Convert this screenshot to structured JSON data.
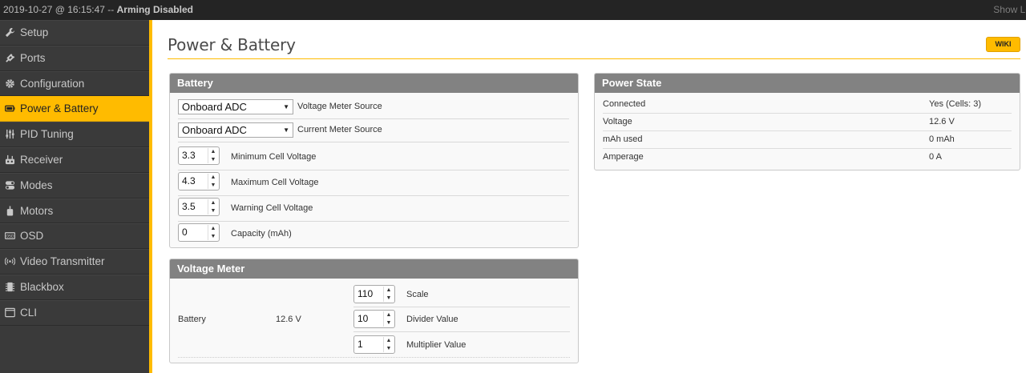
{
  "status_bar": {
    "datetime": "2019-10-27 @ 16:15:47",
    "separator": " -- ",
    "arming": "Arming Disabled",
    "show_log": "Show Lo"
  },
  "sidebar": {
    "items": [
      {
        "label": "Setup",
        "icon": "wrench-icon",
        "active": false
      },
      {
        "label": "Ports",
        "icon": "plug-icon",
        "active": false
      },
      {
        "label": "Configuration",
        "icon": "gear-icon",
        "active": false
      },
      {
        "label": "Power & Battery",
        "icon": "battery-icon",
        "active": true
      },
      {
        "label": "PID Tuning",
        "icon": "sliders-icon",
        "active": false
      },
      {
        "label": "Receiver",
        "icon": "receiver-icon",
        "active": false
      },
      {
        "label": "Modes",
        "icon": "toggles-icon",
        "active": false
      },
      {
        "label": "Motors",
        "icon": "motor-icon",
        "active": false
      },
      {
        "label": "OSD",
        "icon": "osd-icon",
        "active": false
      },
      {
        "label": "Video Transmitter",
        "icon": "antenna-icon",
        "active": false
      },
      {
        "label": "Blackbox",
        "icon": "blackbox-icon",
        "active": false
      },
      {
        "label": "CLI",
        "icon": "terminal-icon",
        "active": false
      }
    ]
  },
  "page": {
    "title": "Power & Battery",
    "wiki": "WIKI"
  },
  "battery": {
    "title": "Battery",
    "voltage_source": {
      "value": "Onboard ADC",
      "label": "Voltage Meter Source"
    },
    "current_source": {
      "value": "Onboard ADC",
      "label": "Current Meter Source"
    },
    "min_cell": {
      "value": "3.3",
      "label": "Minimum Cell Voltage"
    },
    "max_cell": {
      "value": "4.3",
      "label": "Maximum Cell Voltage"
    },
    "warn_cell": {
      "value": "3.5",
      "label": "Warning Cell Voltage"
    },
    "capacity": {
      "value": "0",
      "label": "Capacity (mAh)"
    }
  },
  "voltage_meter": {
    "title": "Voltage Meter",
    "battery_label": "Battery",
    "battery_value": "12.6 V",
    "scale": {
      "value": "110",
      "label": "Scale"
    },
    "divider": {
      "value": "10",
      "label": "Divider Value"
    },
    "multiplier": {
      "value": "1",
      "label": "Multiplier Value"
    }
  },
  "power_state": {
    "title": "Power State",
    "rows": [
      {
        "key": "Connected",
        "value": "Yes (Cells: 3)"
      },
      {
        "key": "Voltage",
        "value": "12.6 V"
      },
      {
        "key": "mAh used",
        "value": "0 mAh"
      },
      {
        "key": "Amperage",
        "value": "0 A"
      }
    ]
  },
  "colors": {
    "accent": "#ffbb00",
    "sidebar_bg": "#3a3a3a",
    "topbar_bg": "#242424",
    "panel_header": "#828282"
  }
}
